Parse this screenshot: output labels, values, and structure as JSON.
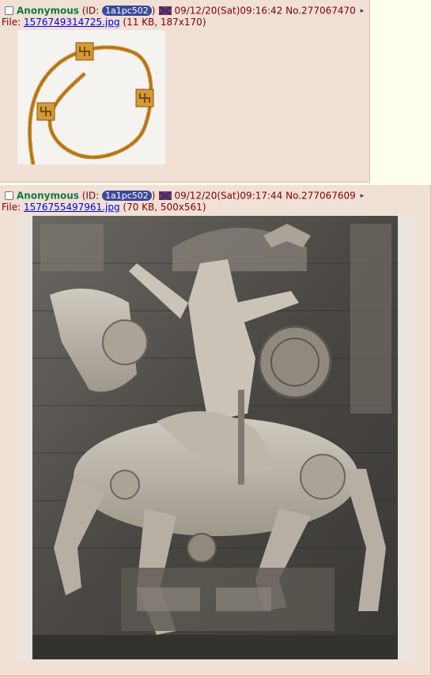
{
  "posts": [
    {
      "name": "Anonymous",
      "id_prefix": "(ID: ",
      "id_value": "1a1pc502",
      "id_suffix": ")",
      "datetime": "09/12/20(Sat)09:16:42",
      "number": "No.277067470",
      "file_label": "File: ",
      "file_name": "1576749314725.jpg",
      "file_meta": "(11 KB, 187x170)"
    },
    {
      "name": "Anonymous",
      "id_prefix": "(ID: ",
      "id_value": "1a1pc502",
      "id_suffix": ")",
      "datetime": "09/12/20(Sat)09:17:44",
      "number": "No.277067609",
      "file_label": "File: ",
      "file_name": "1576755497961.jpg",
      "file_meta": "(70 KB, 500x561)"
    }
  ],
  "menu_arrow": "▸",
  "colors": {
    "post_bg": "#f0e0d6",
    "page_bg": "#ffffee",
    "name": "#117743",
    "id_badge": "#3a4a9a",
    "link": "#0000ee",
    "text": "#800000"
  },
  "icons": {
    "flag": "confederate-flag-icon",
    "menu": "post-menu-arrow-icon"
  }
}
